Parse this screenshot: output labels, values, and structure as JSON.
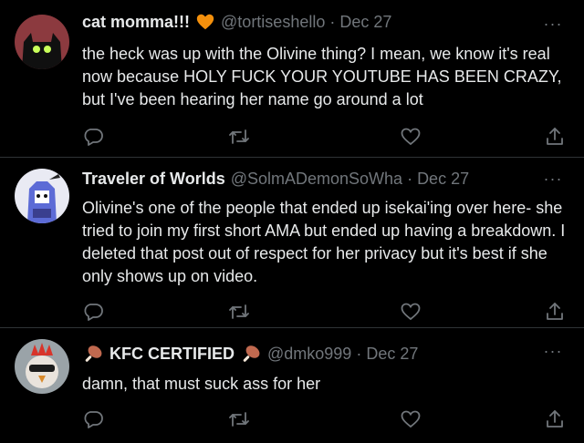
{
  "tweets": [
    {
      "name": "cat momma!!!",
      "handle": "@tortiseshello",
      "date": "Dec 27",
      "text": "the heck was up with the Olivine thing? I mean, we know it's real now because HOLY FUCK YOUR YOUTUBE HAS BEEN CRAZY, but I've been hearing her name go around a lot",
      "badge_icon": "orange-heart-icon",
      "badge_color": "#f4900c"
    },
    {
      "name": "Traveler of Worlds",
      "handle": "@SolmADemonSoWha",
      "date": "Dec 27",
      "text": "Olivine's one of the people that ended up isekai'ing over here- she tried to join my first short AMA but ended up having a breakdown. I deleted that post out of respect for her privacy but it's best if she only shows up on video."
    },
    {
      "name": "KFC CERTIFIED",
      "handle": "@dmko999",
      "date": "Dec 27",
      "text": "damn, that must suck ass for her",
      "name_icon": "poultry-leg-icon"
    }
  ],
  "separator": "·",
  "more_label": "···",
  "icons": {
    "reply": "reply-icon",
    "retweet": "retweet-icon",
    "like": "heart-icon",
    "share": "share-icon"
  },
  "colors": {
    "background": "#000000",
    "text": "#e7e9ea",
    "secondary": "#71767b",
    "divider": "#2f3336"
  }
}
